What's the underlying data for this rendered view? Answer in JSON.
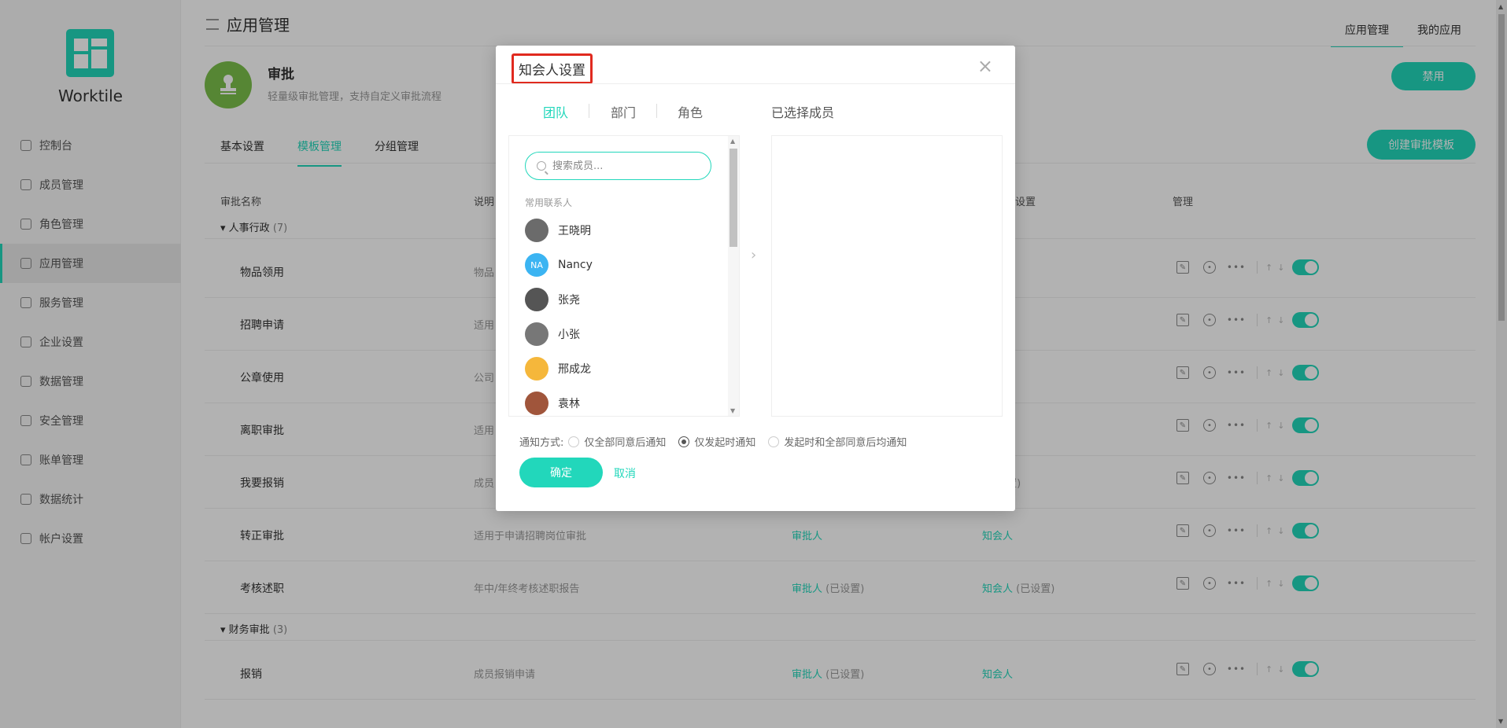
{
  "brand": "Worktile",
  "sidebar": {
    "items": [
      {
        "label": "控制台",
        "icon": "dashboard-icon"
      },
      {
        "label": "成员管理",
        "icon": "members-icon"
      },
      {
        "label": "角色管理",
        "icon": "roles-icon"
      },
      {
        "label": "应用管理",
        "icon": "apps-icon",
        "active": true
      },
      {
        "label": "服务管理",
        "icon": "services-icon"
      },
      {
        "label": "企业设置",
        "icon": "enterprise-icon"
      },
      {
        "label": "数据管理",
        "icon": "data-icon"
      },
      {
        "label": "安全管理",
        "icon": "security-icon"
      },
      {
        "label": "账单管理",
        "icon": "billing-icon"
      },
      {
        "label": "数据统计",
        "icon": "stats-icon"
      },
      {
        "label": "帐户设置",
        "icon": "account-icon"
      }
    ]
  },
  "header": {
    "title": "应用管理",
    "tabs": [
      "应用管理",
      "我的应用"
    ]
  },
  "app": {
    "name": "审批",
    "description": "轻量级审批管理，支持自定义审批流程",
    "disable_label": "禁用"
  },
  "sub_tabs": [
    "基本设置",
    "模板管理",
    "分组管理"
  ],
  "create_label": "创建审批模板",
  "table": {
    "headers": [
      "审批名称",
      "说明",
      "设置",
      "管理"
    ],
    "groups": [
      {
        "label": "人事行政",
        "count": "(7)",
        "rows": [
          {
            "name": "物品领用",
            "desc": "物品",
            "approver": "",
            "notifier": ""
          },
          {
            "name": "招聘申请",
            "desc": "适用",
            "approver": "",
            "notifier": ""
          },
          {
            "name": "公章使用",
            "desc": "公司",
            "approver": "",
            "notifier": ""
          },
          {
            "name": "离职审批",
            "desc": "适用",
            "approver": "",
            "notifier": ""
          },
          {
            "name": "我要报销",
            "desc": "成员",
            "approver": "",
            "notifier": "",
            "notifier_status": "(已设置)"
          },
          {
            "name": "转正审批",
            "desc": "适用于申请招聘岗位审批",
            "approver": "审批人",
            "approver_status": "",
            "notifier": "知会人",
            "notifier_status": ""
          },
          {
            "name": "考核述职",
            "desc": "年中/年终考核述职报告",
            "approver": "审批人",
            "approver_status": "(已设置)",
            "notifier": "知会人",
            "notifier_status": "(已设置)"
          }
        ]
      },
      {
        "label": "财务审批",
        "count": "(3)",
        "rows": [
          {
            "name": "报销",
            "desc": "成员报销申请",
            "approver": "审批人",
            "approver_status": "(已设置)",
            "notifier": "知会人",
            "notifier_status": ""
          }
        ]
      }
    ]
  },
  "modal": {
    "title": "知会人设置",
    "tabs": [
      "团队",
      "部门",
      "角色"
    ],
    "selected_title": "已选择成员",
    "search_placeholder": "搜索成员...",
    "frequent_label": "常用联系人",
    "contacts": [
      {
        "name": "王晓明",
        "color": "#6b6b6b",
        "initials": ""
      },
      {
        "name": "Nancy",
        "color": "#3bb4f2",
        "initials": "NA"
      },
      {
        "name": "张尧",
        "color": "#555555",
        "initials": ""
      },
      {
        "name": "小张",
        "color": "#777777",
        "initials": ""
      },
      {
        "name": "邢成龙",
        "color": "#f5b73b",
        "initials": ""
      },
      {
        "name": "袁林",
        "color": "#a0553b",
        "initials": ""
      }
    ],
    "notify_label": "通知方式:",
    "notify_options": [
      "仅全部同意后通知",
      "仅发起时通知",
      "发起时和全部同意后均通知"
    ],
    "notify_selected": "仅发起时通知",
    "ok_label": "确定",
    "cancel_label": "取消"
  },
  "colors": {
    "accent": "#22d7bb",
    "highlight": "#e02a1f"
  }
}
